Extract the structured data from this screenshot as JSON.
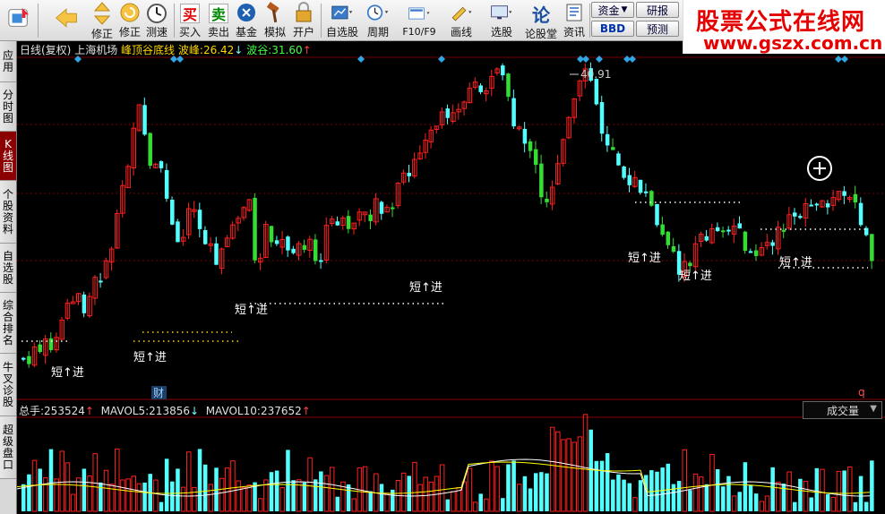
{
  "toolbar": {
    "buttons": [
      {
        "name": "home",
        "label": "",
        "icon": "home-icon"
      },
      {
        "name": "back",
        "label": "",
        "icon": "back-arrow-icon"
      },
      {
        "name": "fix",
        "label": "修正",
        "icon": "updown-arrows-icon"
      },
      {
        "name": "speed",
        "label": "测速",
        "icon": "stopwatch-icon"
      },
      {
        "name": "buy",
        "label": "买入",
        "icon": "buy-icon",
        "glyph": "买"
      },
      {
        "name": "sell",
        "label": "卖出",
        "icon": "sell-icon",
        "glyph": "卖"
      },
      {
        "name": "fund",
        "label": "基金",
        "icon": "fund-icon"
      },
      {
        "name": "simulate",
        "label": "模拟",
        "icon": "hammer-icon"
      },
      {
        "name": "open-account",
        "label": "开户",
        "icon": "lock-icon"
      },
      {
        "name": "watchlist",
        "label": "自选股",
        "icon": "watchlist-icon"
      },
      {
        "name": "period",
        "label": "周期",
        "icon": "clock-icon"
      },
      {
        "name": "f10",
        "label": "F10/F9",
        "icon": "f10-icon"
      },
      {
        "name": "draw",
        "label": "画线",
        "icon": "pencil-icon"
      },
      {
        "name": "pick",
        "label": "选股",
        "icon": "monitor-icon"
      },
      {
        "name": "forum",
        "label": "论股堂",
        "icon": "forum-icon",
        "glyph": "论"
      },
      {
        "name": "news",
        "label": "资讯",
        "icon": "news-icon"
      }
    ],
    "mini_buttons": {
      "capital": "资金",
      "bbd": "BBD",
      "research": "研报",
      "forecast": "预测"
    }
  },
  "brand": {
    "title": "股票公式在线网",
    "url": "www.gszx.com.cn"
  },
  "side_tabs": [
    "应用",
    "分时图",
    "K线图",
    "个股资料",
    "自选股",
    "综合排名",
    "牛叉诊股",
    "超级盘口"
  ],
  "active_side_tab": 2,
  "main_panel": {
    "period": "日线(复权)",
    "stock": "上海机场",
    "indicator": "峰顶谷底线",
    "peak_label": "波峰:",
    "peak_value": "26.42",
    "peak_arrow": "↓",
    "trough_label": "波谷:",
    "trough_value": "31.60",
    "trough_arrow": "↑",
    "high_label": "40.91",
    "signal_text": "短↑进",
    "finance_marker": "财",
    "q_marker": "q"
  },
  "volume_panel": {
    "total_label": "总手:",
    "total_value": "253524",
    "total_arrow": "↑",
    "ma5_label": "MAVOL5:",
    "ma5_value": "213856",
    "ma5_arrow": "↓",
    "ma10_label": "MAVOL10:",
    "ma10_value": "237652",
    "ma10_arrow": "↑",
    "selector": "成交量"
  },
  "colors": {
    "up": "#ff2020",
    "down": "#54ffff",
    "green": "#33dd33",
    "ma5": "#ffffff",
    "ma10": "#ffff00",
    "grid": "#7a0000",
    "diamond": "#2fa6e6"
  }
}
